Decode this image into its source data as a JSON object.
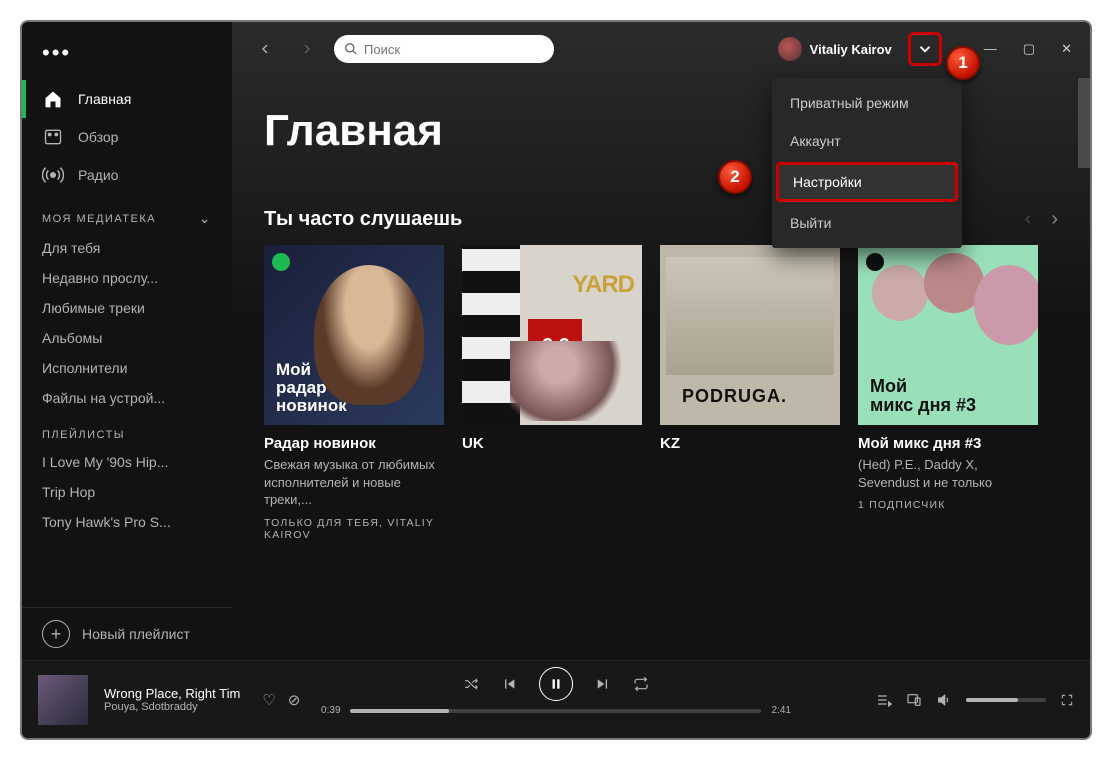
{
  "search": {
    "placeholder": "Поиск"
  },
  "user": {
    "name": "Vitaliy Kairov"
  },
  "sidebar": {
    "nav": [
      {
        "label": "Главная",
        "active": true
      },
      {
        "label": "Обзор"
      },
      {
        "label": "Радио"
      }
    ],
    "library_header": "МОЯ МЕДИАТЕКА",
    "library": [
      "Для тебя",
      "Недавно прослу...",
      "Любимые треки",
      "Альбомы",
      "Исполнители",
      "Файлы на устрой..."
    ],
    "playlists_header": "ПЛЕЙЛИСТЫ",
    "playlists": [
      "I Love My '90s Hip...",
      "Trip Hop",
      "Tony Hawk's Pro S..."
    ],
    "new_playlist": "Новый плейлист"
  },
  "dropdown": {
    "items": [
      "Приватный режим",
      "Аккаунт",
      "Настройки",
      "Выйти"
    ],
    "highlight_index": 2
  },
  "page": {
    "title": "Главная",
    "section": "Ты часто слушаешь"
  },
  "cards": [
    {
      "cover_text": "Мой\nрадар\nновинок",
      "title": "Радар новинок",
      "sub": "Свежая музыка от любимых исполнителей и новые треки,...",
      "meta": "ТОЛЬКО ДЛЯ ТЕБЯ, VITALIY KAIROV"
    },
    {
      "title": "UK",
      "sub": "",
      "meta": ""
    },
    {
      "title": "KZ",
      "sub": "",
      "meta": ""
    },
    {
      "cover_text": "Мой\nмикс дня #3",
      "title": "Мой микс дня #3",
      "sub": "(Hed) P.E., Daddy X, Sevendust и не только",
      "meta": "1 ПОДПИСЧИК"
    }
  ],
  "player": {
    "title": "Wrong Place, Right Tim",
    "artist": "Pouya, Sdotbraddy",
    "elapsed": "0:39",
    "total": "2:41"
  },
  "annotations": {
    "b1": "1",
    "b2": "2"
  }
}
